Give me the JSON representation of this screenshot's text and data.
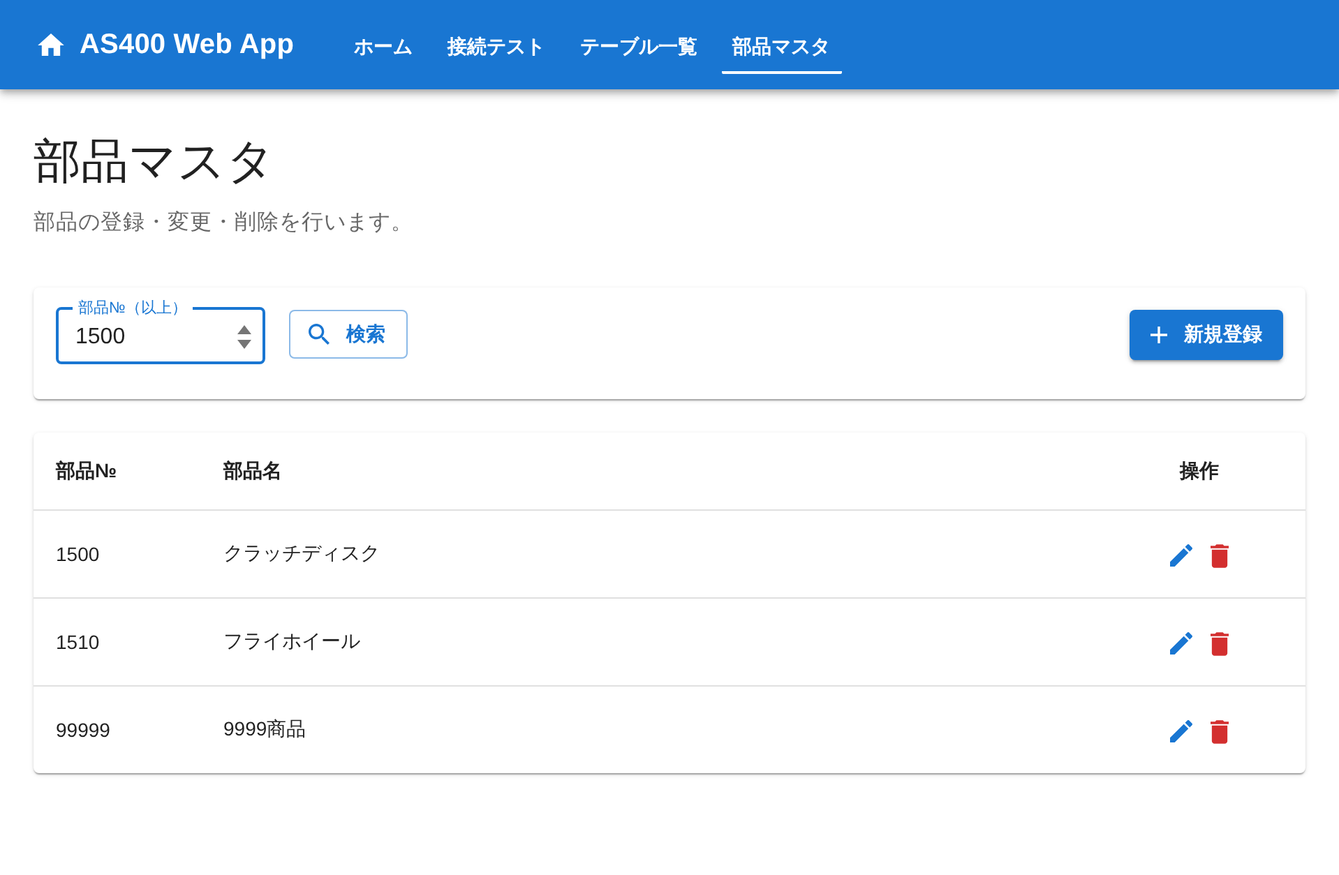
{
  "app_bar": {
    "title": "AS400 Web App",
    "nav": [
      {
        "label": "ホーム",
        "selected": false
      },
      {
        "label": "接続テスト",
        "selected": false
      },
      {
        "label": "テーブル一覧",
        "selected": false
      },
      {
        "label": "部品マスタ",
        "selected": true
      }
    ]
  },
  "page": {
    "title": "部品マスタ",
    "subtitle": "部品の登録・変更・削除を行います。"
  },
  "search": {
    "field": {
      "label": "部品№（以上）",
      "value": "1500",
      "focused": true
    },
    "search_button": "検索",
    "new_button": "新規登録"
  },
  "table": {
    "columns": [
      "部品№",
      "部品名",
      "操作"
    ],
    "rows": [
      {
        "cells": [
          "1500",
          "クラッチディスク"
        ],
        "actions": [
          {
            "kind": "edit"
          },
          {
            "kind": "delete"
          }
        ]
      },
      {
        "cells": [
          "1510",
          "フライホイール"
        ],
        "actions": [
          {
            "kind": "edit"
          },
          {
            "kind": "delete"
          }
        ]
      },
      {
        "cells": [
          "99999",
          "9999商品"
        ],
        "actions": [
          {
            "kind": "edit"
          },
          {
            "kind": "delete"
          }
        ]
      }
    ]
  }
}
